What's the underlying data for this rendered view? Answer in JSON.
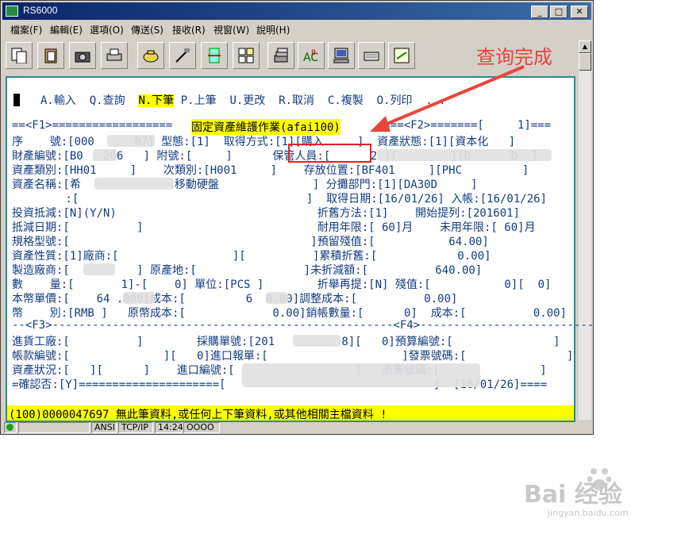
{
  "window": {
    "title": "RS6000",
    "min": "_",
    "max": "□",
    "close": "✕"
  },
  "menu": [
    "檔案(F)",
    "編輯(E)",
    "選項(O)",
    "傳送(S)",
    "接收(R)",
    "視窗(W)",
    "說明(H)"
  ],
  "toolbar_icons": [
    "copy-icon",
    "clipboard-icon",
    "camera-icon",
    "printer-icon",
    "phone-icon",
    "cable-icon",
    "transfer-icon",
    "grid-icon",
    "stack-icon",
    "spell-check-icon",
    "computer-icon",
    "keyboard-icon",
    "screen-icon"
  ],
  "terminal": {
    "actions": "A.輸入  Q.查詢  N.下筆  P.上筆  U.更改  R.取消  C.複製  O.列印  ...",
    "actions_pre": "A.輸入  Q.查詢  ",
    "actions_hl": "N.下筆",
    "actions_post": " P.上筆  U.更改  R.取消  C.複製  O.列印  ...",
    "lines": [
      "==<F1>==================",
      "序    號:[000      07] 型態:[1]  取得方式:[1][購入     ]  資產狀態:[1][資本化   ]",
      "財產編號:[B0   206   ] 附號:[     ]      保管人員:[      2 ][        ][D      D  ]",
      "資產類別:[HH01     ]    次類別:[H001     ]    存放位置:[BF401     ][PHC         ]",
      "資產名稱:[希              移動硬盤              ] 分攤部門:[1][DA30D     ]",
      "        :[                                  ]  取得日期:[16/01/26] 入帳:[16/01/26]",
      "投資抵減:[N](Y/N)                              折舊方法:[1]    開始提列:[201601]",
      "抵減日期:[          ]                          耐用年限:[ 60]月    未用年限:[ 60]月",
      "規格型號:[                                    ]預留殘值:[           64.00]",
      "資產性質:[1]廠商:[                 ][          ]累積折舊:[            0.00]",
      "製造廠商:[          ] 原產地:[                ]未折減額:[          640.00]",
      "數    量:[       1]-[    0] 單位:[PCS ]        折舉再提:[N] 殘值:[           0][  0]",
      "本幣單價:[    64 .000]成本:[         6  0.00]調整成本:[          0.00]",
      "幣    別:[RMB ]   原幣成本:[             0.00]銷帳數量:[      0]  成本:[          0.00]",
      "--<F3>---------------------------------------------------<F4>--------------------------",
      "進貨工廠:[          ]        採購單號:[201          8][   0]預算編號:[               ]",
      "帳款編號:[              ][   0]進口報單:[                    ]發票號碼:[               ]",
      "資產狀況:[   ][      ]    進口編號:[                  ]   憑票號碼:[               ]",
      "=確認否:[Y]=====================[                               ]  [16/01/26]===="
    ],
    "f1_title": "固定資產維護作業(afai100)",
    "f2_tail": "====<F2>=======[     1]===",
    "status_message": "(100)0000047697 無此筆資料,或任何上下筆資料,或其他相關主檔資料 !"
  },
  "statusbar": {
    "encoding": "ANSI",
    "protocol": "TCP/IP",
    "time": "14:24",
    "mode": "OOOO"
  },
  "annotation": {
    "text": "查询完成",
    "color": "#e8453c"
  },
  "watermark": {
    "brand": "Bai  经验",
    "url": "jingyan.baidu.com"
  }
}
